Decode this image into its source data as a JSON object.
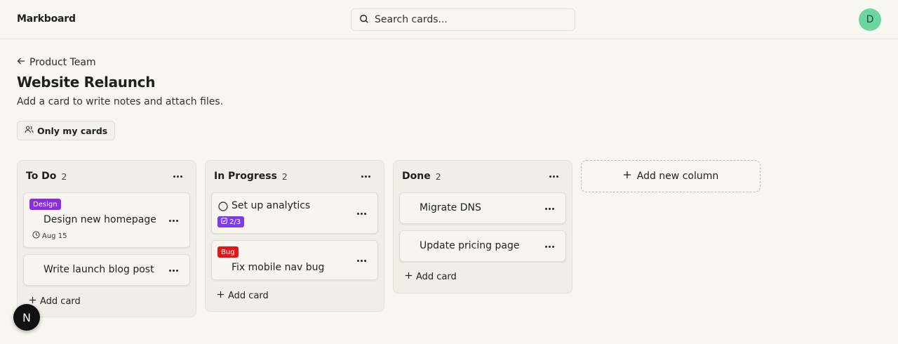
{
  "app": {
    "name": "Markboard"
  },
  "search": {
    "placeholder": "Search cards..."
  },
  "user": {
    "initial": "D",
    "avatar_color": "#6dd6a0"
  },
  "breadcrumb": {
    "back_label": "Product Team"
  },
  "page": {
    "title": "Website Relaunch",
    "subtitle": "Add a card to write notes and attach files."
  },
  "filter": {
    "label": "Only my cards"
  },
  "columns": [
    {
      "title": "To Do",
      "count": "2",
      "add_label": "Add card",
      "cards": [
        {
          "tag": "Design",
          "tag_color": "#8b2be2",
          "title": "Design new homepage",
          "due": "Aug 15"
        },
        {
          "title": "Write launch blog post"
        }
      ]
    },
    {
      "title": "In Progress",
      "count": "2",
      "add_label": "Add card",
      "cards": [
        {
          "title": "Set up analytics",
          "checklist": "2/3",
          "checklist_color": "#7c3aed"
        },
        {
          "tag": "Bug",
          "tag_color": "#e01818",
          "title": "Fix mobile nav bug"
        }
      ]
    },
    {
      "title": "Done",
      "count": "2",
      "add_label": "Add card",
      "cards": [
        {
          "title": "Migrate DNS"
        },
        {
          "title": "Update pricing page"
        }
      ]
    }
  ],
  "add_column": {
    "label": "Add new column"
  },
  "dev_badge": {
    "label": "N"
  }
}
